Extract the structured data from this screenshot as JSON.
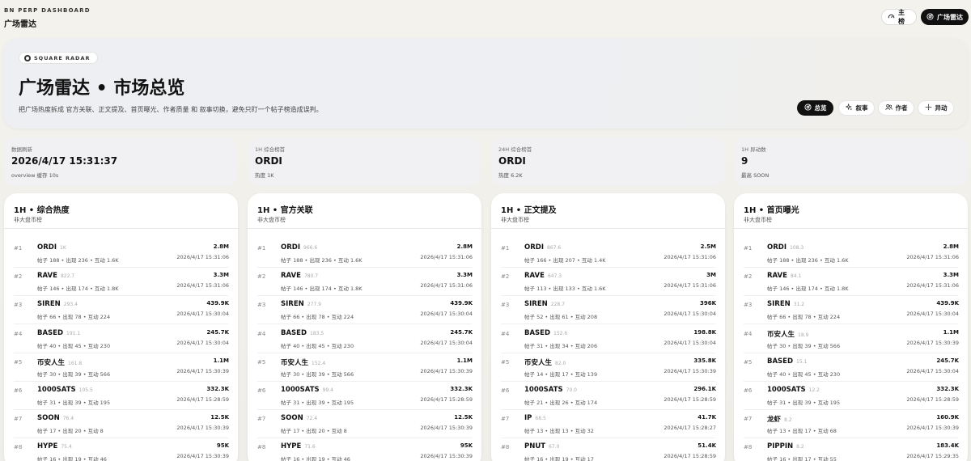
{
  "header": {
    "brand_sub": "BN PERP DASHBOARD",
    "brand_title": "广场雷达",
    "nav": [
      {
        "label": "主榜",
        "icon": "gauge-icon"
      },
      {
        "label": "广场雷达",
        "icon": "radar-icon",
        "active": true
      }
    ]
  },
  "hero": {
    "badge": "SQUARE RADAR",
    "title": "广场雷达 • 市场总览",
    "description": "把广场热度拆成 官方关联、正文提及、首页曝光、作者质量 和 叙事切换，避免只盯一个帖子榜造成误判。",
    "filters": [
      {
        "label": "总览",
        "icon": "radar-icon",
        "active": true
      },
      {
        "label": "叙事",
        "icon": "sparkle-icon"
      },
      {
        "label": "作者",
        "icon": "users-icon"
      },
      {
        "label": "异动",
        "icon": "pulse-icon"
      }
    ]
  },
  "stats": [
    {
      "label": "数据刷新",
      "value": "2026/4/17 15:31:37",
      "sub": "overview 缓存 10s"
    },
    {
      "label": "1H 综合榜首",
      "value": "ORDI",
      "sub": "热度 1K"
    },
    {
      "label": "24H 综合榜首",
      "value": "ORDI",
      "sub": "热度 6.2K"
    },
    {
      "label": "1H 异动数",
      "value": "9",
      "sub": "最高 SOON"
    }
  ],
  "rankings": [
    {
      "title": "1H • 综合热度",
      "subtitle": "非大盘币榜",
      "rows": [
        {
          "rank": "#1",
          "name": "ORDI",
          "score": "1K",
          "meta": "帖子 188 • 出现 236 • 互动 1.6K",
          "value": "2.8M",
          "time": "2026/4/17 15:31:06"
        },
        {
          "rank": "#2",
          "name": "RAVE",
          "score": "822.7",
          "meta": "帖子 146 • 出现 174 • 互动 1.8K",
          "value": "3.3M",
          "time": "2026/4/17 15:31:06"
        },
        {
          "rank": "#3",
          "name": "SIREN",
          "score": "293.4",
          "meta": "帖子 66 • 出现 78 • 互动 224",
          "value": "439.9K",
          "time": "2026/4/17 15:30:04"
        },
        {
          "rank": "#4",
          "name": "BASED",
          "score": "191.1",
          "meta": "帖子 40 • 出现 45 • 互动 230",
          "value": "245.7K",
          "time": "2026/4/17 15:30:04"
        },
        {
          "rank": "#5",
          "name": "币安人生",
          "score": "161.8",
          "meta": "帖子 30 • 出现 39 • 互动 566",
          "value": "1.1M",
          "time": "2026/4/17 15:30:39"
        },
        {
          "rank": "#6",
          "name": "1000SATS",
          "score": "105.5",
          "meta": "帖子 31 • 出现 39 • 互动 195",
          "value": "332.3K",
          "time": "2026/4/17 15:28:59"
        },
        {
          "rank": "#7",
          "name": "SOON",
          "score": "76.4",
          "meta": "帖子 17 • 出现 20 • 互动 8",
          "value": "12.5K",
          "time": "2026/4/17 15:30:39"
        },
        {
          "rank": "#8",
          "name": "HYPE",
          "score": "75.4",
          "meta": "帖子 16 • 出现 19 • 互动 46",
          "value": "95K",
          "time": "2026/4/17 15:30:39"
        }
      ]
    },
    {
      "title": "1H • 官方关联",
      "subtitle": "非大盘币榜",
      "rows": [
        {
          "rank": "#1",
          "name": "ORDI",
          "score": "966.6",
          "meta": "帖子 188 • 出现 236 • 互动 1.6K",
          "value": "2.8M",
          "time": "2026/4/17 15:31:06"
        },
        {
          "rank": "#2",
          "name": "RAVE",
          "score": "780.7",
          "meta": "帖子 146 • 出现 174 • 互动 1.8K",
          "value": "3.3M",
          "time": "2026/4/17 15:31:06"
        },
        {
          "rank": "#3",
          "name": "SIREN",
          "score": "277.9",
          "meta": "帖子 66 • 出现 78 • 互动 224",
          "value": "439.9K",
          "time": "2026/4/17 15:30:04"
        },
        {
          "rank": "#4",
          "name": "BASED",
          "score": "183.5",
          "meta": "帖子 40 • 出现 45 • 互动 230",
          "value": "245.7K",
          "time": "2026/4/17 15:30:04"
        },
        {
          "rank": "#5",
          "name": "币安人生",
          "score": "152.4",
          "meta": "帖子 30 • 出现 39 • 互动 566",
          "value": "1.1M",
          "time": "2026/4/17 15:30:39"
        },
        {
          "rank": "#6",
          "name": "1000SATS",
          "score": "99.4",
          "meta": "帖子 31 • 出现 39 • 互动 195",
          "value": "332.3K",
          "time": "2026/4/17 15:28:59"
        },
        {
          "rank": "#7",
          "name": "SOON",
          "score": "72.4",
          "meta": "帖子 17 • 出现 20 • 互动 8",
          "value": "12.5K",
          "time": "2026/4/17 15:30:39"
        },
        {
          "rank": "#8",
          "name": "HYPE",
          "score": "71.6",
          "meta": "帖子 16 • 出现 19 • 互动 46",
          "value": "95K",
          "time": "2026/4/17 15:30:39"
        }
      ]
    },
    {
      "title": "1H • 正文提及",
      "subtitle": "非大盘币榜",
      "rows": [
        {
          "rank": "#1",
          "name": "ORDI",
          "score": "867.6",
          "meta": "帖子 166 • 出现 207 • 互动 1.4K",
          "value": "2.5M",
          "time": "2026/4/17 15:31:06"
        },
        {
          "rank": "#2",
          "name": "RAVE",
          "score": "647.3",
          "meta": "帖子 113 • 出现 133 • 互动 1.6K",
          "value": "3M",
          "time": "2026/4/17 15:31:06"
        },
        {
          "rank": "#3",
          "name": "SIREN",
          "score": "228.7",
          "meta": "帖子 52 • 出现 61 • 互动 208",
          "value": "396K",
          "time": "2026/4/17 15:30:04"
        },
        {
          "rank": "#4",
          "name": "BASED",
          "score": "152.6",
          "meta": "帖子 31 • 出现 34 • 互动 206",
          "value": "198.8K",
          "time": "2026/4/17 15:30:04"
        },
        {
          "rank": "#5",
          "name": "币安人生",
          "score": "82.0",
          "meta": "帖子 14 • 出现 17 • 互动 139",
          "value": "335.8K",
          "time": "2026/4/17 15:30:39"
        },
        {
          "rank": "#6",
          "name": "1000SATS",
          "score": "70.0",
          "meta": "帖子 21 • 出现 26 • 互动 174",
          "value": "296.1K",
          "time": "2026/4/17 15:28:59"
        },
        {
          "rank": "#7",
          "name": "IP",
          "score": "68.5",
          "meta": "帖子 13 • 出现 13 • 互动 32",
          "value": "41.7K",
          "time": "2026/4/17 15:28:27"
        },
        {
          "rank": "#8",
          "name": "PNUT",
          "score": "67.0",
          "meta": "帖子 16 • 出现 19 • 互动 17",
          "value": "51.4K",
          "time": "2026/4/17 15:28:59"
        }
      ]
    },
    {
      "title": "1H • 首页曝光",
      "subtitle": "非大盘币榜",
      "rows": [
        {
          "rank": "#1",
          "name": "ORDI",
          "score": "108.3",
          "meta": "帖子 188 • 出现 236 • 互动 1.6K",
          "value": "2.8M",
          "time": "2026/4/17 15:31:06"
        },
        {
          "rank": "#2",
          "name": "RAVE",
          "score": "84.1",
          "meta": "帖子 146 • 出现 174 • 互动 1.8K",
          "value": "3.3M",
          "time": "2026/4/17 15:31:06"
        },
        {
          "rank": "#3",
          "name": "SIREN",
          "score": "31.2",
          "meta": "帖子 66 • 出现 78 • 互动 224",
          "value": "439.9K",
          "time": "2026/4/17 15:30:04"
        },
        {
          "rank": "#4",
          "name": "币安人生",
          "score": "18.9",
          "meta": "帖子 30 • 出现 39 • 互动 566",
          "value": "1.1M",
          "time": "2026/4/17 15:30:39"
        },
        {
          "rank": "#5",
          "name": "BASED",
          "score": "15.1",
          "meta": "帖子 40 • 出现 45 • 互动 230",
          "value": "245.7K",
          "time": "2026/4/17 15:30:04"
        },
        {
          "rank": "#6",
          "name": "1000SATS",
          "score": "12.2",
          "meta": "帖子 31 • 出现 39 • 互动 195",
          "value": "332.3K",
          "time": "2026/4/17 15:28:59"
        },
        {
          "rank": "#7",
          "name": "龙虾",
          "score": "8.2",
          "meta": "帖子 13 • 出现 17 • 互动 68",
          "value": "160.9K",
          "time": "2026/4/17 15:30:39"
        },
        {
          "rank": "#8",
          "name": "PIPPIN",
          "score": "8.2",
          "meta": "帖子 16 • 出现 17 • 互动 55",
          "value": "183.4K",
          "time": "2026/4/17 15:29:35"
        }
      ]
    }
  ]
}
